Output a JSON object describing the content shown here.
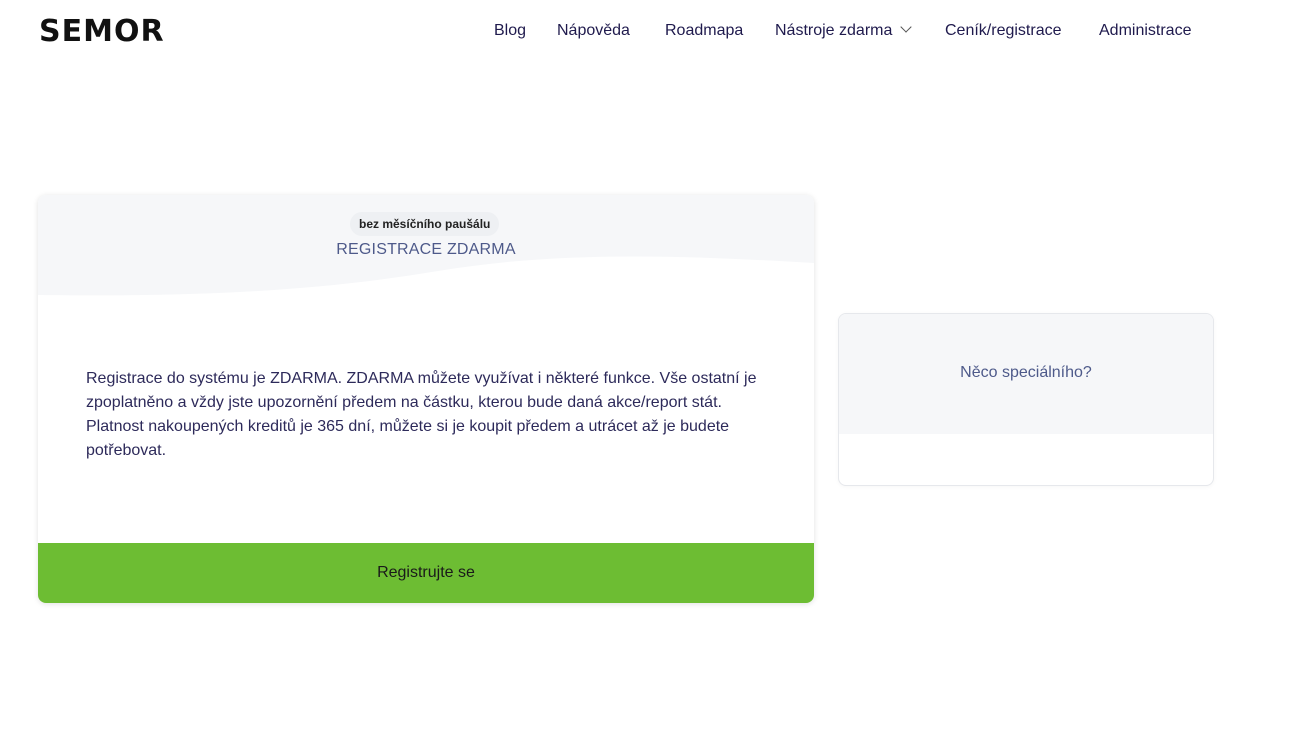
{
  "header": {
    "logo_text": "SEMOR",
    "nav": [
      {
        "label": "Blog"
      },
      {
        "label": "Nápověda"
      },
      {
        "label": "Roadmapa"
      },
      {
        "label": "Nástroje zdarma"
      },
      {
        "label": "Ceník/registrace"
      },
      {
        "label": "Administrace"
      }
    ]
  },
  "plan_card": {
    "badge": "bez měsíčního paušálu",
    "title": "REGISTRACE ZDARMA",
    "description": "Registrace do systému je ZDARMA. ZDARMA můžete využívat i některé funkce. Vše ostatní je zpoplatněno a vždy jste upozornění předem na částku, kterou bude daná akce/report stát. Platnost nakoupených kreditů je 365 dní, můžete si je koupit předem a utrácet až je budete potřebovat.",
    "button_label": "Registrujte se",
    "button_color": "#6dbd33"
  },
  "special_card": {
    "title": "Něco speciálního?"
  }
}
